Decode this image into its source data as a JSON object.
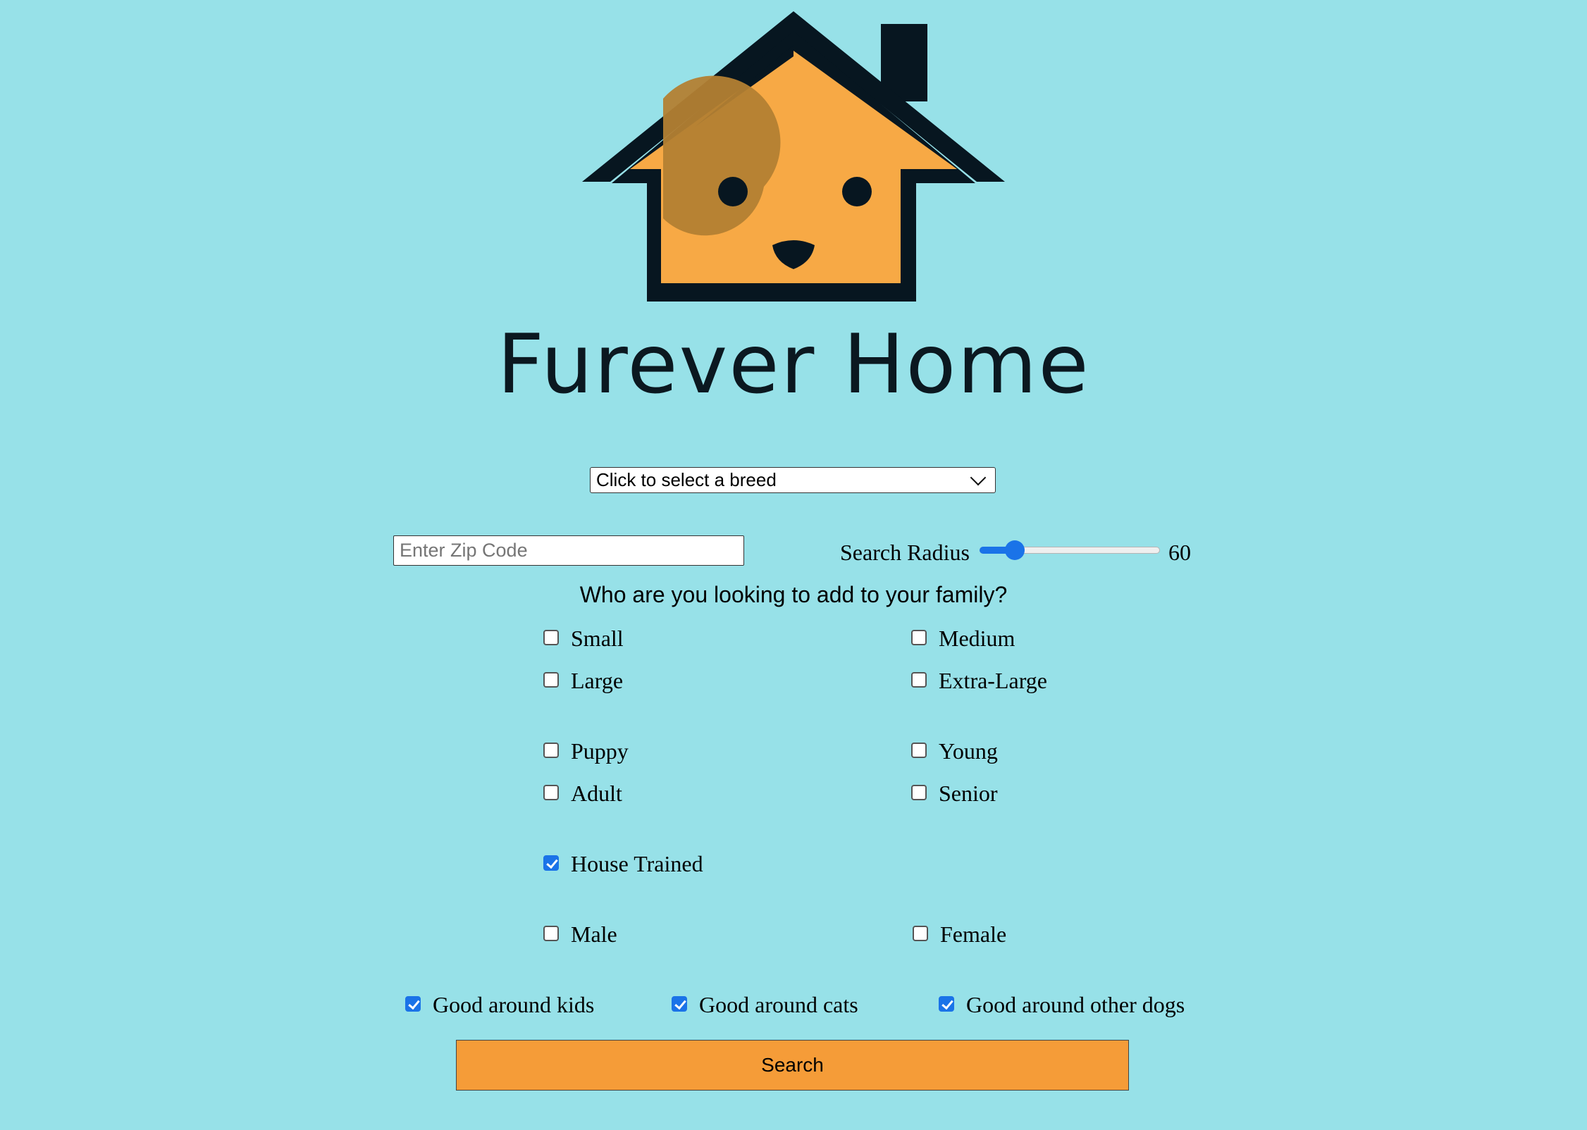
{
  "brand": {
    "title": "Furever Home"
  },
  "breed_select": {
    "selected": "Click to select a breed"
  },
  "zip": {
    "placeholder": "Enter Zip Code",
    "value": ""
  },
  "radius": {
    "label": "Search Radius",
    "value": "60",
    "fraction": 0.16
  },
  "question": "Who are you looking to add to your family?",
  "filters": {
    "small": {
      "label": "Small",
      "checked": false
    },
    "medium": {
      "label": "Medium",
      "checked": false
    },
    "large": {
      "label": "Large",
      "checked": false
    },
    "extra_large": {
      "label": "Extra-Large",
      "checked": false
    },
    "puppy": {
      "label": "Puppy",
      "checked": false
    },
    "young": {
      "label": "Young",
      "checked": false
    },
    "adult": {
      "label": "Adult",
      "checked": false
    },
    "senior": {
      "label": "Senior",
      "checked": false
    },
    "house_trained": {
      "label": "House Trained",
      "checked": true
    },
    "male": {
      "label": "Male",
      "checked": false
    },
    "female": {
      "label": "Female",
      "checked": false
    },
    "good_kids": {
      "label": "Good around kids",
      "checked": true
    },
    "good_cats": {
      "label": "Good around cats",
      "checked": true
    },
    "good_dogs": {
      "label": "Good around other dogs",
      "checked": true
    }
  },
  "search_button": "Search",
  "colors": {
    "background": "#97e1e8",
    "logo_orange": "#f7a945",
    "logo_dark": "#071620",
    "accent_blue": "#1a73e8",
    "button_orange": "#f59c38"
  }
}
